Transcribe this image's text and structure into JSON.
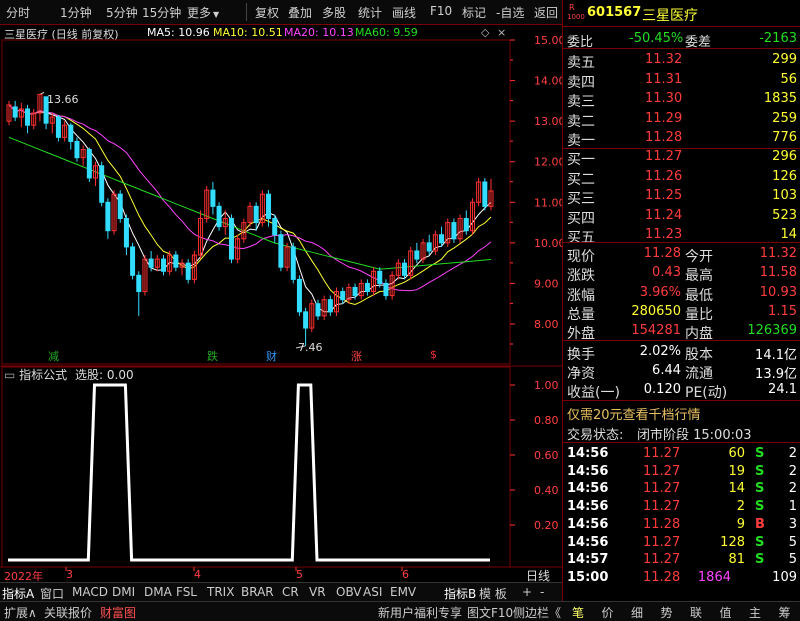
{
  "toolbar": {
    "left_items": [
      "分时",
      "1分钟",
      "5分钟",
      "15分钟",
      "更多"
    ],
    "right_items": [
      "复权",
      "叠加",
      "多股",
      "统计",
      "画线",
      "F10",
      "标记",
      "-自选",
      "返回"
    ]
  },
  "chart_header": {
    "title": "三星医疗 (日线 前复权)",
    "ma5": "MA5: 10.96",
    "ma10": "MA10: 10.51",
    "ma20": "MA20: 10.13",
    "ma60": "MA60: 9.59",
    "colors": {
      "ma5": "#ffffff",
      "ma10": "#ffff33",
      "ma20": "#ff44ff",
      "ma60": "#22dd22"
    }
  },
  "indicator_header": {
    "title": "指标公式",
    "value": "选股: 0.00"
  },
  "chart_data": [
    {
      "type": "candlestick",
      "title": "三星医疗 (日线 前复权)",
      "y_ticks": [
        "15.00",
        "14.00",
        "13.00",
        "12.00",
        "11.00",
        "10.00",
        "9.00",
        "8.00"
      ],
      "ylim": [
        7.6,
        15.1
      ],
      "x_ticks": [
        "2022年",
        "3",
        "4",
        "5",
        "6"
      ],
      "annotations": {
        "high": "13.66",
        "low": "7.46"
      },
      "markers": [
        {
          "label": "减",
          "color": "#22aa22"
        },
        {
          "label": "跌",
          "color": "#22aa22"
        },
        {
          "label": "财",
          "color": "#3399ff"
        },
        {
          "label": "涨",
          "color": "#ff4444"
        },
        {
          "label": "$",
          "color": "#ff3333"
        }
      ],
      "candles": [
        [
          13.0,
          13.4,
          12.9,
          13.5
        ],
        [
          13.35,
          13.1,
          13.0,
          13.5
        ],
        [
          13.1,
          13.3,
          12.85,
          13.45
        ],
        [
          13.3,
          12.9,
          12.7,
          13.4
        ],
        [
          12.9,
          13.2,
          12.8,
          13.3
        ],
        [
          13.2,
          13.66,
          13.0,
          13.66
        ],
        [
          13.6,
          12.95,
          12.8,
          13.6
        ],
        [
          12.95,
          13.1,
          12.7,
          13.2
        ],
        [
          13.1,
          12.6,
          12.5,
          13.15
        ],
        [
          12.6,
          12.9,
          12.5,
          13.0
        ],
        [
          12.9,
          12.5,
          12.3,
          12.95
        ],
        [
          12.5,
          12.1,
          12.0,
          12.6
        ],
        [
          12.1,
          12.3,
          11.9,
          12.4
        ],
        [
          12.3,
          11.6,
          11.5,
          12.35
        ],
        [
          11.6,
          11.9,
          11.4,
          12.0
        ],
        [
          11.9,
          11.0,
          10.9,
          12.0
        ],
        [
          11.0,
          10.3,
          10.1,
          11.1
        ],
        [
          10.3,
          11.2,
          10.2,
          11.3
        ],
        [
          11.2,
          10.6,
          10.5,
          11.3
        ],
        [
          10.6,
          9.9,
          9.7,
          10.7
        ],
        [
          9.9,
          9.2,
          9.1,
          10.0
        ],
        [
          9.2,
          8.8,
          8.2,
          9.3
        ],
        [
          8.8,
          9.6,
          8.7,
          9.7
        ],
        [
          9.6,
          9.4,
          9.3,
          9.8
        ],
        [
          9.4,
          9.6,
          9.3,
          9.7
        ],
        [
          9.6,
          9.3,
          9.2,
          9.7
        ],
        [
          9.3,
          9.7,
          9.2,
          9.8
        ],
        [
          9.7,
          9.4,
          9.3,
          9.8
        ],
        [
          9.4,
          9.5,
          9.2,
          9.6
        ],
        [
          9.5,
          9.1,
          9.0,
          9.6
        ],
        [
          9.1,
          9.7,
          9.0,
          9.8
        ],
        [
          9.7,
          10.6,
          9.6,
          10.8
        ],
        [
          10.6,
          11.3,
          10.5,
          11.4
        ],
        [
          11.3,
          10.9,
          10.7,
          11.5
        ],
        [
          10.9,
          10.4,
          10.3,
          11.0
        ],
        [
          10.4,
          10.6,
          10.2,
          10.8
        ],
        [
          10.6,
          9.6,
          9.5,
          10.7
        ],
        [
          9.6,
          10.1,
          9.5,
          10.2
        ],
        [
          10.1,
          10.5,
          10.0,
          10.6
        ],
        [
          10.5,
          10.9,
          10.4,
          11.0
        ],
        [
          10.9,
          10.5,
          10.3,
          11.0
        ],
        [
          10.5,
          11.2,
          10.4,
          11.3
        ],
        [
          11.2,
          10.6,
          10.4,
          11.3
        ],
        [
          10.6,
          10.2,
          10.0,
          10.7
        ],
        [
          10.2,
          9.4,
          9.3,
          10.3
        ],
        [
          9.4,
          9.9,
          9.3,
          10.0
        ],
        [
          9.9,
          9.1,
          9.0,
          10.0
        ],
        [
          9.1,
          8.3,
          8.2,
          9.2
        ],
        [
          8.3,
          7.9,
          7.46,
          8.4
        ],
        [
          7.9,
          8.5,
          7.8,
          8.6
        ],
        [
          8.5,
          8.2,
          8.1,
          8.6
        ],
        [
          8.2,
          8.6,
          8.1,
          8.7
        ],
        [
          8.6,
          8.3,
          8.2,
          8.7
        ],
        [
          8.3,
          8.8,
          8.2,
          8.9
        ],
        [
          8.8,
          8.6,
          8.5,
          8.9
        ],
        [
          8.6,
          8.9,
          8.5,
          9.0
        ],
        [
          8.9,
          8.7,
          8.6,
          9.0
        ],
        [
          8.7,
          9.0,
          8.6,
          9.1
        ],
        [
          9.0,
          8.8,
          8.7,
          9.1
        ],
        [
          8.8,
          9.3,
          8.7,
          9.4
        ],
        [
          9.3,
          9.0,
          8.9,
          9.4
        ],
        [
          9.0,
          8.7,
          8.6,
          9.1
        ],
        [
          8.7,
          9.2,
          8.6,
          9.3
        ],
        [
          9.2,
          9.5,
          9.1,
          9.6
        ],
        [
          9.5,
          9.2,
          9.1,
          9.6
        ],
        [
          9.2,
          9.8,
          9.1,
          9.9
        ],
        [
          9.8,
          9.6,
          9.5,
          10.0
        ],
        [
          9.6,
          10.0,
          9.5,
          10.1
        ],
        [
          10.0,
          9.8,
          9.7,
          10.2
        ],
        [
          9.8,
          10.2,
          9.7,
          10.3
        ],
        [
          10.2,
          10.0,
          9.9,
          10.4
        ],
        [
          10.0,
          10.5,
          9.9,
          10.6
        ],
        [
          10.5,
          10.1,
          10.0,
          10.6
        ],
        [
          10.1,
          10.6,
          10.0,
          10.7
        ],
        [
          10.6,
          10.3,
          10.2,
          10.8
        ],
        [
          10.3,
          11.0,
          10.2,
          11.1
        ],
        [
          11.0,
          11.5,
          10.9,
          11.6
        ],
        [
          11.5,
          10.9,
          10.8,
          11.6
        ],
        [
          10.9,
          11.28,
          10.8,
          11.58
        ]
      ]
    },
    {
      "type": "line",
      "title": "指标公式",
      "y_ticks": [
        "1.00",
        "0.80",
        "0.60",
        "0.40",
        "0.20",
        "0.00"
      ],
      "ylim": [
        0,
        1.08
      ],
      "values": [
        0,
        0,
        0,
        0,
        0,
        0,
        0,
        0,
        0,
        0,
        0,
        0,
        0,
        0,
        1,
        1,
        1,
        1,
        1,
        1,
        0,
        0,
        0,
        0,
        0,
        0,
        0,
        0,
        0,
        0,
        0,
        0,
        0,
        0,
        0,
        0,
        0,
        0,
        0,
        0,
        0,
        0,
        0,
        0,
        0,
        0,
        0,
        1,
        1,
        1,
        0,
        0,
        0,
        0,
        0,
        0,
        0,
        0,
        0,
        0,
        0,
        0,
        0,
        0,
        0,
        0,
        0,
        0,
        0,
        0,
        0,
        0,
        0,
        0,
        0,
        0,
        0,
        0,
        0
      ]
    }
  ],
  "panel": {
    "code": "601567",
    "name": "三星医疗",
    "badge_top": "R",
    "badge_bottom": "1000",
    "weibi_label": "委比",
    "weibi": "-50.45%",
    "weicha_label": "委差",
    "weicha": "-2163",
    "sells": [
      {
        "label": "卖五",
        "price": "11.32",
        "vol": "299"
      },
      {
        "label": "卖四",
        "price": "11.31",
        "vol": "56"
      },
      {
        "label": "卖三",
        "price": "11.30",
        "vol": "1835"
      },
      {
        "label": "卖二",
        "price": "11.29",
        "vol": "259"
      },
      {
        "label": "卖一",
        "price": "11.28",
        "vol": "776"
      }
    ],
    "buys": [
      {
        "label": "买一",
        "price": "11.27",
        "vol": "296"
      },
      {
        "label": "买二",
        "price": "11.26",
        "vol": "126"
      },
      {
        "label": "买三",
        "price": "11.25",
        "vol": "103"
      },
      {
        "label": "买四",
        "price": "11.24",
        "vol": "523"
      },
      {
        "label": "买五",
        "price": "11.23",
        "vol": "14"
      }
    ],
    "quote": [
      {
        "l1": "现价",
        "v1": "11.28",
        "c1": "red",
        "l2": "今开",
        "v2": "11.32",
        "c2": "red"
      },
      {
        "l1": "涨跌",
        "v1": "0.43",
        "c1": "red",
        "l2": "最高",
        "v2": "11.58",
        "c2": "red"
      },
      {
        "l1": "涨幅",
        "v1": "3.96%",
        "c1": "red",
        "l2": "最低",
        "v2": "10.93",
        "c2": "red"
      },
      {
        "l1": "总量",
        "v1": "280650",
        "c1": "yellow",
        "l2": "量比",
        "v2": "1.15",
        "c2": "red"
      },
      {
        "l1": "外盘",
        "v1": "154281",
        "c1": "red",
        "l2": "内盘",
        "v2": "126369",
        "c2": "green"
      }
    ],
    "stats": [
      {
        "l1": "换手",
        "v1": "2.02%",
        "l2": "股本",
        "v2": "14.1亿"
      },
      {
        "l1": "净资",
        "v1": "6.44",
        "l2": "流通",
        "v2": "13.9亿"
      },
      {
        "l1": "收益(一)",
        "v1": "0.120",
        "l2": "PE(动)",
        "v2": "24.1"
      }
    ],
    "promo": "仅需20元查看千档行情",
    "status_label": "交易状态:",
    "status_value": "闭市阶段 15:00:03",
    "ticks": [
      {
        "time": "14:56",
        "price": "11.27",
        "vol": "60",
        "side": "S",
        "n": "2"
      },
      {
        "time": "14:56",
        "price": "11.27",
        "vol": "19",
        "side": "S",
        "n": "2"
      },
      {
        "time": "14:56",
        "price": "11.27",
        "vol": "14",
        "side": "S",
        "n": "2"
      },
      {
        "time": "14:56",
        "price": "11.27",
        "vol": "2",
        "side": "S",
        "n": "1"
      },
      {
        "time": "14:56",
        "price": "11.28",
        "vol": "9",
        "side": "B",
        "n": "3"
      },
      {
        "time": "14:56",
        "price": "11.27",
        "vol": "128",
        "side": "S",
        "n": "5"
      },
      {
        "time": "14:57",
        "price": "11.27",
        "vol": "81",
        "side": "S",
        "n": "5"
      },
      {
        "time": "15:00",
        "price": "11.28",
        "vol": "1864",
        "side": "",
        "n": "109"
      }
    ]
  },
  "tabs1": [
    "指标A",
    "窗口",
    "MACD",
    "DMI",
    "DMA",
    "FSL",
    "TRIX",
    "BRAR",
    "CR",
    "VR",
    "OBV",
    "ASI",
    "EMV",
    "指标B",
    "模 板",
    "+",
    "-",
    "日线"
  ],
  "tabs2_left": [
    "扩展∧",
    "关联报价",
    "财富图"
  ],
  "tabs2_right": [
    "新用户福利专享",
    "图文F10",
    "侧边栏《"
  ],
  "tabs2_panel": [
    "笔",
    "价",
    "细",
    "势",
    "联",
    "值",
    "主",
    "筹"
  ]
}
